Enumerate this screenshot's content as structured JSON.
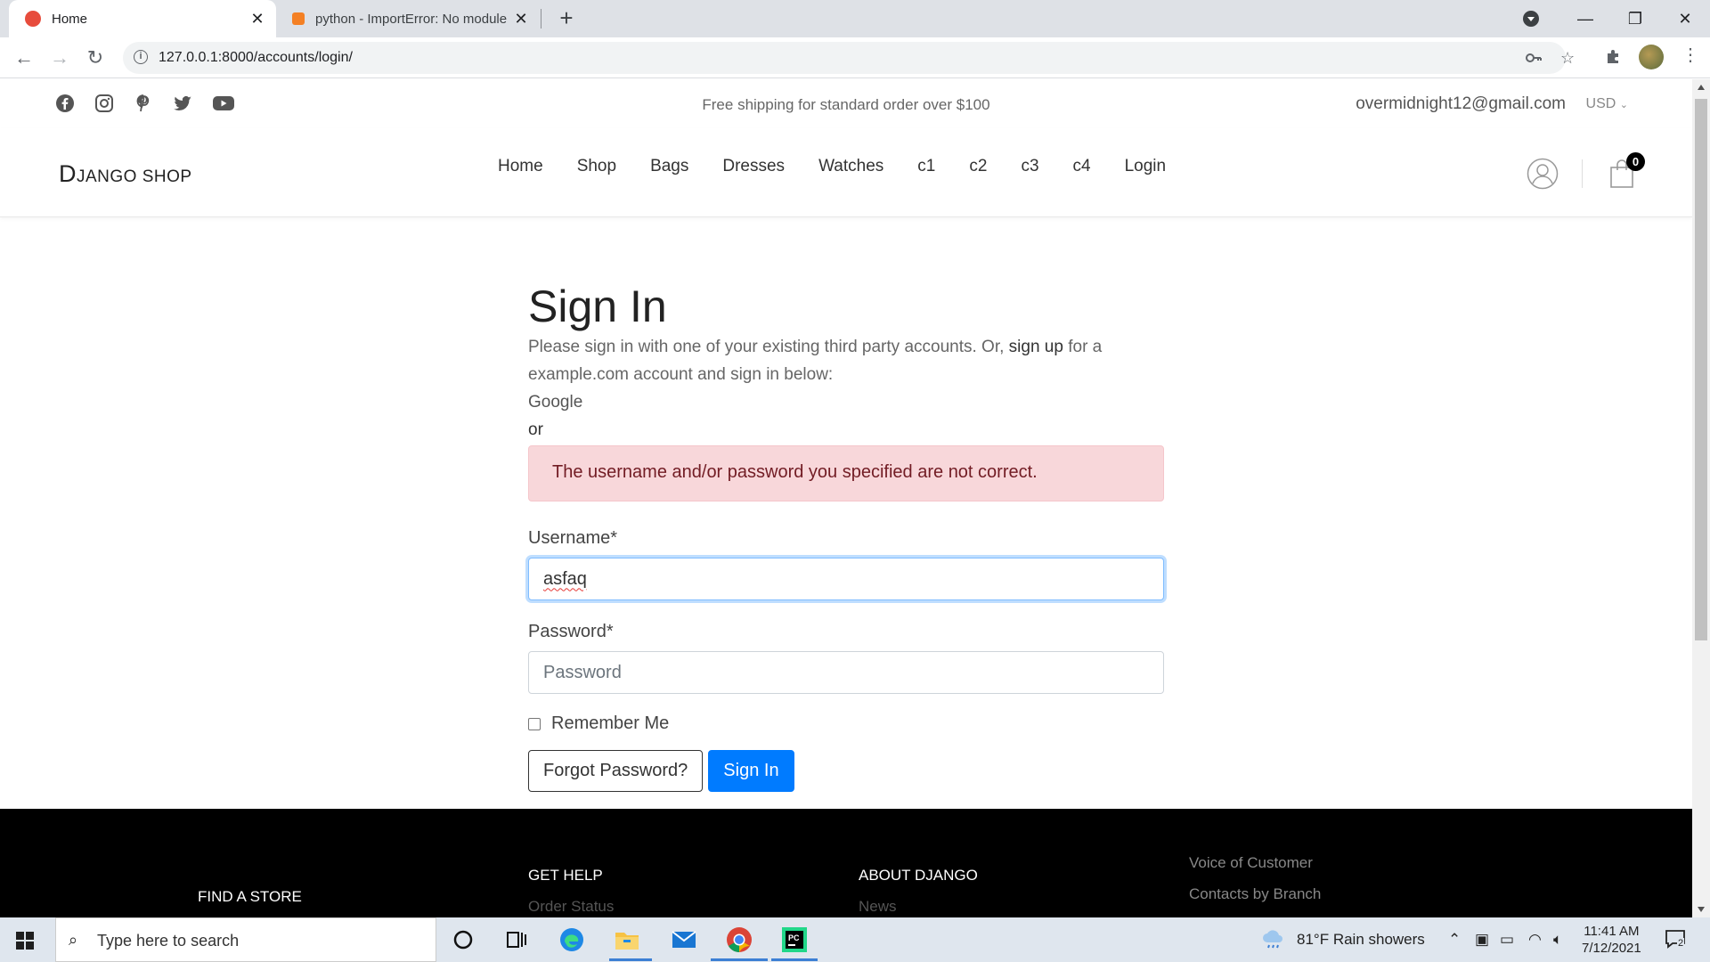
{
  "browser": {
    "tabs": [
      {
        "title": "Home",
        "active": true
      },
      {
        "title": "python - ImportError: No module",
        "active": false
      }
    ],
    "url": "127.0.0.1:8000/accounts/login/"
  },
  "topbar": {
    "shipping": "Free shipping for standard order over $100",
    "email": "overmidnight12@gmail.com",
    "currency": "USD"
  },
  "header": {
    "logo_first": "D",
    "logo_rest": "JANGO SHOP",
    "nav": [
      "Home",
      "Shop",
      "Bags",
      "Dresses",
      "Watches",
      "c1",
      "c2",
      "c3",
      "c4",
      "Login"
    ],
    "cart_count": "0"
  },
  "login": {
    "title": "Sign In",
    "intro_before": "Please sign in with one of your existing third party accounts. Or, ",
    "signup_link": "sign up",
    "intro_after": " for a example.com account and sign in below:",
    "provider": "Google",
    "or": "or",
    "error": "The username and/or password you specified are not correct.",
    "username_label": "Username*",
    "username_value": "asfaq",
    "password_label": "Password*",
    "password_placeholder": "Password",
    "remember": "Remember Me",
    "forgot": "Forgot Password?",
    "submit": "Sign In"
  },
  "footer": {
    "find_store": "FIND A STORE",
    "get_help": "GET HELP",
    "order_status": "Order Status",
    "about": "ABOUT DJANGO",
    "news": "News",
    "voice": "Voice of Customer",
    "contacts": "Contacts by Branch"
  },
  "taskbar": {
    "search": "Type here to search",
    "weather": "81°F  Rain showers",
    "time": "11:41 AM",
    "date": "7/12/2021",
    "notifications": "2"
  }
}
